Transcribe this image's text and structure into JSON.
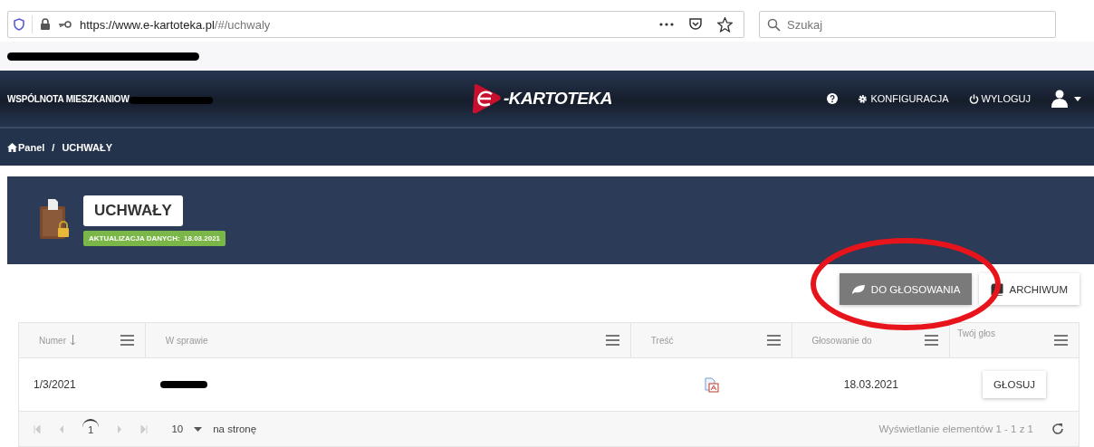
{
  "browser": {
    "url_host": "https://www.e-kartoteka.pl",
    "url_path": "/#/uchwaly",
    "search": {
      "placeholder": "Szukaj"
    }
  },
  "header": {
    "organization": "WSPÓLNOTA MIESZKANIOW",
    "logo_text": "-KARTOTEKA",
    "nav": [
      {
        "kind": "help"
      },
      {
        "kind": "settings",
        "label": "KONFIGURACJA"
      },
      {
        "kind": "logout",
        "label": "WYLOGUJ"
      },
      {
        "kind": "user"
      }
    ]
  },
  "breadcrumbs": [
    {
      "label": "Panel",
      "kind": "home"
    },
    {
      "label": "/",
      "kind": "separator"
    },
    {
      "label": "UCHWAŁY",
      "kind": "current"
    }
  ],
  "page": {
    "title": "UCHWAŁY",
    "badge": "AKTUALIZACJA DANYCH:  18.03.2021"
  },
  "view_buttons": [
    {
      "label": "DO GŁOSOWANIA",
      "kind": "voting",
      "selected": true
    },
    {
      "label": "ARCHIWUM",
      "kind": "archive",
      "selected": false
    }
  ],
  "table": {
    "columns": [
      {
        "label": "Numer",
        "sorted": true
      },
      {
        "label": "W sprawie",
        "sorted": false
      },
      {
        "label": "Treść",
        "sorted": false
      },
      {
        "label": "Głosowanie do",
        "sorted": false
      },
      {
        "label": "Twój głos",
        "sorted": false
      }
    ],
    "rows": [
      {
        "number": "1/3/2021",
        "subject_redacted": true,
        "deadline": "18.03.2021",
        "action": "GŁOSUJ"
      }
    ]
  },
  "pager": {
    "pages": [
      {
        "label": "1",
        "selected": true
      }
    ],
    "page_size": "10",
    "page_size_label": "na stronę",
    "summary": "Wyświetlanie elementów 1 - 1 z 1"
  }
}
